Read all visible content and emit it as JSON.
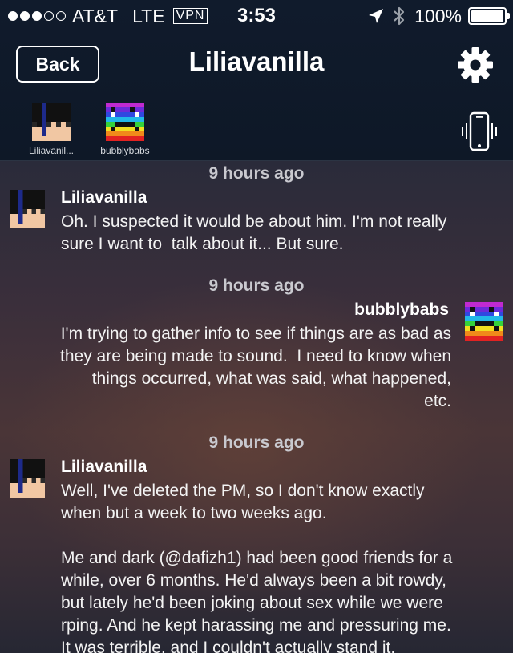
{
  "status_bar": {
    "signal_dots": [
      true,
      true,
      true,
      false,
      false
    ],
    "carrier": "AT&T",
    "network": "LTE",
    "vpn": "VPN",
    "time": "3:53",
    "battery": "100%",
    "battery_level": 1.0
  },
  "nav": {
    "back_label": "Back",
    "title": "Liliavanilla",
    "settings_icon": "gear-icon"
  },
  "participants": [
    {
      "name": "Liliavanil...",
      "avatar": "dark-hair-avatar"
    },
    {
      "name": "bubblybabs",
      "avatar": "rainbow-avatar"
    }
  ],
  "messages": [
    {
      "timestamp": "9 hours ago",
      "author": "Liliavanilla",
      "side": "left",
      "text": "Oh. I suspected it would be about him. I'm not really\nsure I want to  talk about it... But sure."
    },
    {
      "timestamp": "9 hours ago",
      "author": "bubblybabs",
      "side": "right",
      "text": "I'm trying to gather info to see if things are as bad as\nthey are being made to sound.  I need to know when\nthings occurred, what was said, what happened,\netc."
    },
    {
      "timestamp": "9 hours ago",
      "author": "Liliavanilla",
      "side": "left",
      "text": "Well, I've deleted the PM, so I don't know exactly\nwhen but a week to two weeks ago.\n\nMe and dark (@dafizh1) had been good friends for a\nwhile, over 6 months. He'd always been a bit rowdy,\nbut lately he'd been joking about sex while we were\nrping. And he kept harassing me and pressuring me.\nIt was terrible, and I couldn't actually stand it."
    }
  ],
  "colors": {
    "header_bg": "#101b2c",
    "text": "#ffffff",
    "timestamp": "#c9c9cf"
  }
}
